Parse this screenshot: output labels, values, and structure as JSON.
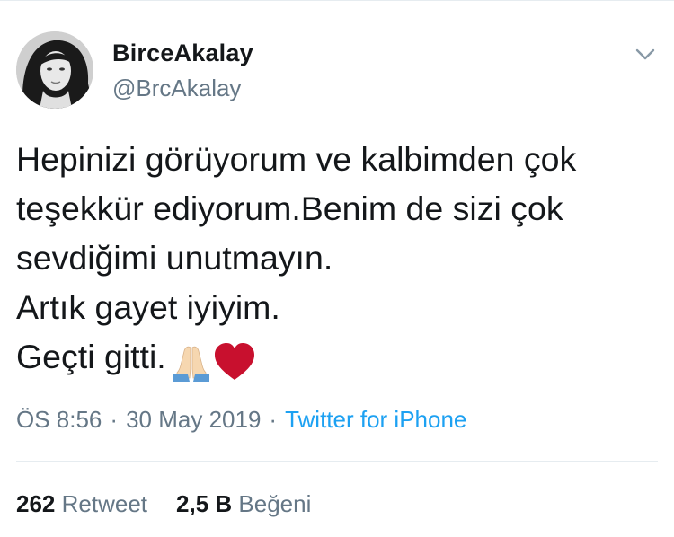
{
  "tweet": {
    "display_name": "BirceAkalay",
    "handle": "@BrcAkalay",
    "lines": [
      "Hepinizi görüyorum ve kalbimden çok",
      "teşekkür ediyorum.Benim de sizi çok",
      "sevdiğimi unutmayın.",
      "Artık gayet iyiyim.",
      "Geçti gitti."
    ],
    "emojis": [
      "folded-hands",
      "red-heart"
    ],
    "time": "ÖS 8:56",
    "date": "30 May 2019",
    "separator": "·",
    "source": "Twitter for iPhone"
  },
  "stats": {
    "retweets_count": "262",
    "retweets_label": "Retweet",
    "likes_count": "2,5 B",
    "likes_label": "Beğeni"
  },
  "colors": {
    "text": "#14171a",
    "secondary": "#657786",
    "link": "#1da1f2",
    "divider": "#e6ecf0",
    "heart": "#c8102e"
  },
  "icons": {
    "menu": "chevron-down-icon",
    "emoji1": "folded-hands-emoji",
    "emoji2": "red-heart-emoji"
  }
}
